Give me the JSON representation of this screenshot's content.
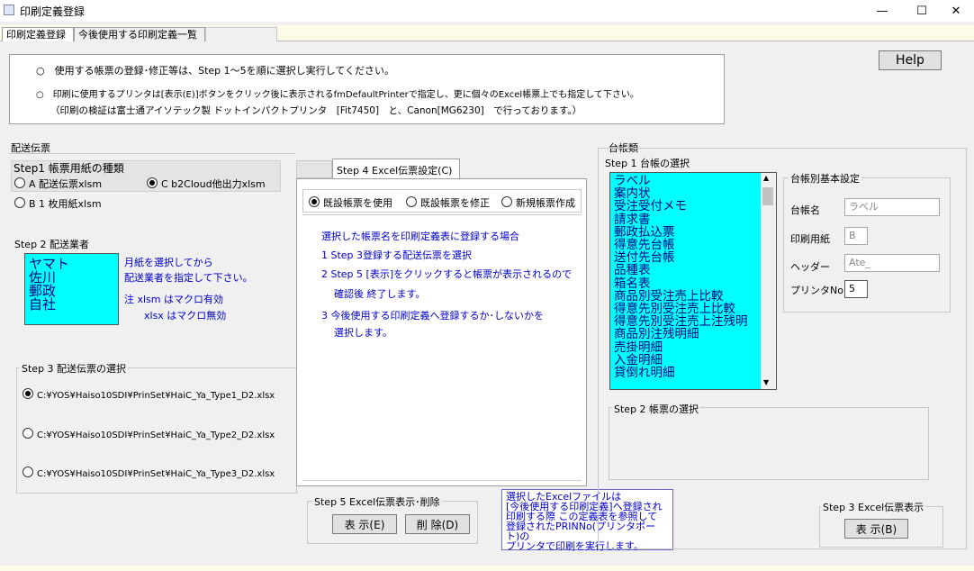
{
  "window": {
    "title": "印刷定義登録",
    "minimize": "—",
    "maximize": "☐",
    "close": "✕"
  },
  "tabs": [
    "印刷定義登録",
    "今後使用する印刷定義一覧"
  ],
  "info": {
    "line1": "○　使用する帳票の登録･修正等は、Step 1～5を順に選択し実行してください。",
    "line2": "○　印刷に使用するプリンタは[表示(E)]ボタンをクリック後に表示されるfmDefaultPrinterで指定し、更に個々のExcel帳票上でも指定して下さい。",
    "line3": "（印刷の検証は富士通アイソテック製 ドットインパクトプリンタ　[Fit7450]　と、Canon[MG6230]　で行っております。）"
  },
  "help_label": "Help",
  "haiso": {
    "section_label": "配送伝票",
    "step1_label": "Step1  帳票用紙の種類",
    "opt_a": "A  配送伝票xlsm",
    "opt_b": "B  1 枚用紙xlsm",
    "opt_c": "C  b2Cloud他出力xlsm",
    "step2_label": "Step 2  配送業者",
    "carriers": [
      "ヤマト",
      "佐川",
      "郵政",
      "自社"
    ],
    "note1": "月紙を選択してから",
    "note2": "配送業者を指定して下さい。",
    "note3": "注  xlsm はマクロ有効",
    "note4": "xlsx はマクロ無効",
    "step3_label": "Step 3  配送伝票の選択",
    "files": [
      "C:¥YOS¥Haiso10SDI¥PrinSet¥HaiC_Ya_Type1_D2.xlsx",
      "C:¥YOS¥Haiso10SDI¥PrinSet¥HaiC_Ya_Type2_D2.xlsx",
      "C:¥YOS¥Haiso10SDI¥PrinSet¥HaiC_Ya_Type3_D2.xlsx"
    ]
  },
  "step4": {
    "tab_label": "Step 4  Excel伝票設定(C)",
    "opt1": "既設帳票を使用",
    "opt2": "既設帳票を修正",
    "opt3": "新規帳票作成",
    "lines": [
      "選択した帳票名を印刷定義表に登録する場合",
      "1  Step 3登録する配送伝票を選択",
      "2  Step 5 [表示]をクリックすると帳票が表示されるので",
      "確認後 終了します。",
      "3  今後使用する印刷定義へ登録するか･しないかを",
      "選択します。"
    ]
  },
  "step5": {
    "label": "Step 5  Excel伝票表示･削除",
    "show": "表 示(E)",
    "delete": "削 除(D)"
  },
  "info_box": [
    "選択したExcelファイルは",
    "[今後使用する印刷定義]へ登録され",
    "印刷する際 この定義表を参照して",
    "登録されたPRINNo(プリンタポート)の",
    "プリンタで印刷を実行します。"
  ],
  "daicho": {
    "section_label": "台帳類",
    "step1_label": "Step 1  台帳の選択",
    "list": [
      "ラベル",
      "案内状",
      "受注受付メモ",
      "請求書",
      "郵政払込票",
      "得意先台帳",
      "送付先台帳",
      "品種表",
      "箱名表",
      "商品別受注売上比較",
      "得意先別受注売上比較",
      "得意先別受注売上注残明",
      "商品別注残明細",
      "売掛明細",
      "入金明細",
      "貸倒れ明細"
    ],
    "kihon_label": "台帳別基本設定",
    "fields": [
      {
        "label": "台帳名",
        "value": "ラベル"
      },
      {
        "label": "印刷用紙",
        "value": "B"
      },
      {
        "label": "ヘッダー",
        "value": "Ate_"
      },
      {
        "label": "プリンタNo",
        "value": "5"
      }
    ],
    "step2_label": "Step 2  帳票の選択",
    "step3_label": "Step 3  Excel伝票表示",
    "show_label": "表 示(B)"
  }
}
